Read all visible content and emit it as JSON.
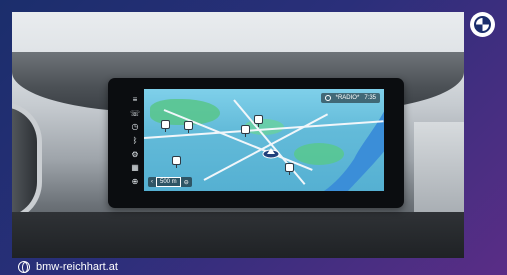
{
  "brand": {
    "logo_icon": "bmw-logo",
    "url_text": "bmw-reichhart.at",
    "url_icon": "globe-icon"
  },
  "display": {
    "sidebar_icons": [
      "menu-icon",
      "phone-icon",
      "clock-icon",
      "bluetooth-icon",
      "settings-icon",
      "map-icon",
      "navigation-icon"
    ],
    "status": {
      "radio_label": "*RADIO*",
      "time": "7:35"
    },
    "map": {
      "scale_label": "500 m"
    }
  },
  "colors": {
    "frame_blue": "#1b2e6c",
    "frame_purple": "#5a2d86",
    "map_water": "#3b8ed8",
    "map_land": "#63bbd9",
    "map_green": "#58c58a"
  }
}
